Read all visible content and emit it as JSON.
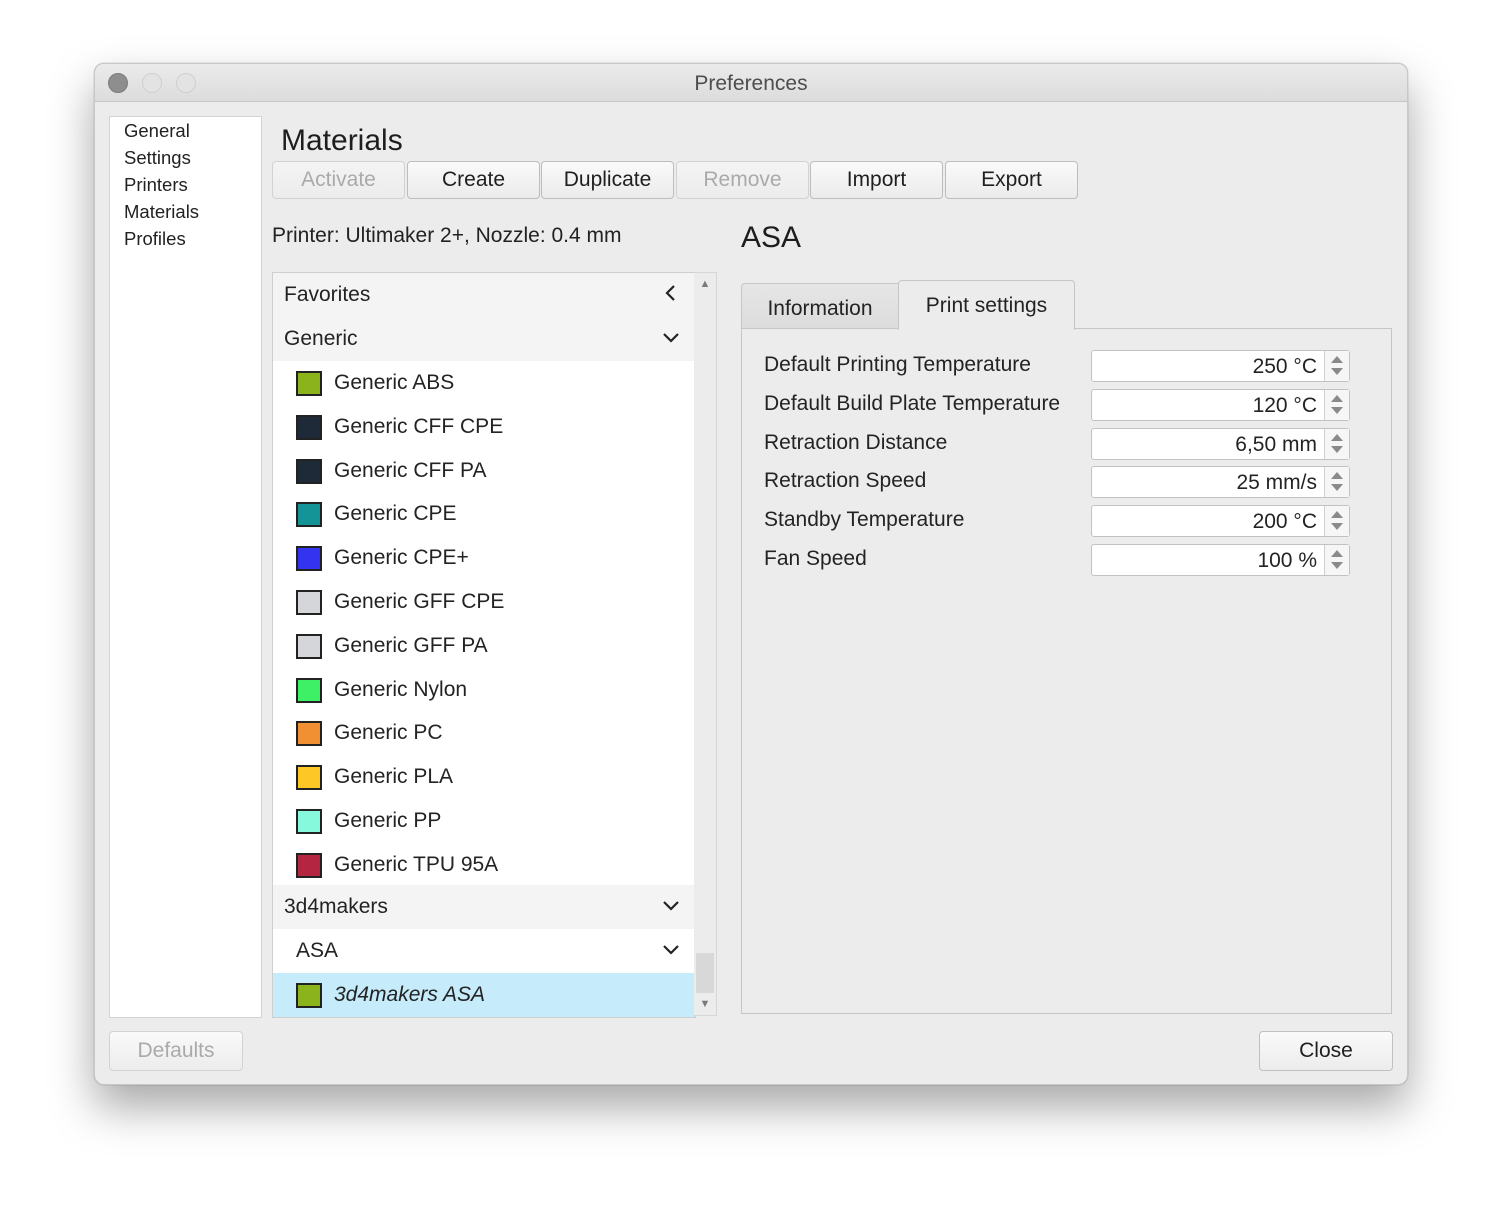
{
  "window": {
    "title": "Preferences"
  },
  "sidebar": {
    "items": [
      {
        "label": "General"
      },
      {
        "label": "Settings"
      },
      {
        "label": "Printers"
      },
      {
        "label": "Materials"
      },
      {
        "label": "Profiles"
      }
    ]
  },
  "page": {
    "title": "Materials"
  },
  "toolbar": {
    "activate_label": "Activate",
    "create_label": "Create",
    "duplicate_label": "Duplicate",
    "remove_label": "Remove",
    "import_label": "Import",
    "export_label": "Export"
  },
  "printer_info": "Printer: Ultimaker 2+, Nozzle: 0.4 mm",
  "materials_list": {
    "favorites": {
      "label": "Favorites",
      "state": "collapsed"
    },
    "generic": {
      "label": "Generic",
      "state": "expanded",
      "items": [
        {
          "label": "Generic ABS",
          "color": "#8bb31c"
        },
        {
          "label": "Generic CFF CPE",
          "color": "#1f2a38"
        },
        {
          "label": "Generic CFF PA",
          "color": "#1f2a38"
        },
        {
          "label": "Generic CPE",
          "color": "#159497"
        },
        {
          "label": "Generic CPE+",
          "color": "#3434f0"
        },
        {
          "label": "Generic GFF CPE",
          "color": "#d4d6da"
        },
        {
          "label": "Generic GFF PA",
          "color": "#d4d6da"
        },
        {
          "label": "Generic Nylon",
          "color": "#3ef066"
        },
        {
          "label": "Generic PC",
          "color": "#f09033"
        },
        {
          "label": "Generic PLA",
          "color": "#fdc825"
        },
        {
          "label": "Generic PP",
          "color": "#86f8dc"
        },
        {
          "label": "Generic TPU 95A",
          "color": "#b42541"
        }
      ]
    },
    "brand": {
      "label": "3d4makers",
      "state": "expanded",
      "type_group": {
        "label": "ASA",
        "state": "expanded",
        "items": [
          {
            "label": "3d4makers ASA",
            "color": "#8bb31c",
            "selected": true
          }
        ]
      }
    }
  },
  "detail": {
    "title": "ASA",
    "tabs": [
      {
        "label": "Information",
        "active": false
      },
      {
        "label": "Print settings",
        "active": true
      }
    ],
    "settings": [
      {
        "label": "Default Printing Temperature",
        "value": "250 °C"
      },
      {
        "label": "Default Build Plate Temperature",
        "value": "120 °C"
      },
      {
        "label": "Retraction Distance",
        "value": "6,50 mm"
      },
      {
        "label": "Retraction Speed",
        "value": "25 mm/s"
      },
      {
        "label": "Standby Temperature",
        "value": "200 °C"
      },
      {
        "label": "Fan Speed",
        "value": "100 %"
      }
    ]
  },
  "footer": {
    "defaults_label": "Defaults",
    "close_label": "Close"
  }
}
